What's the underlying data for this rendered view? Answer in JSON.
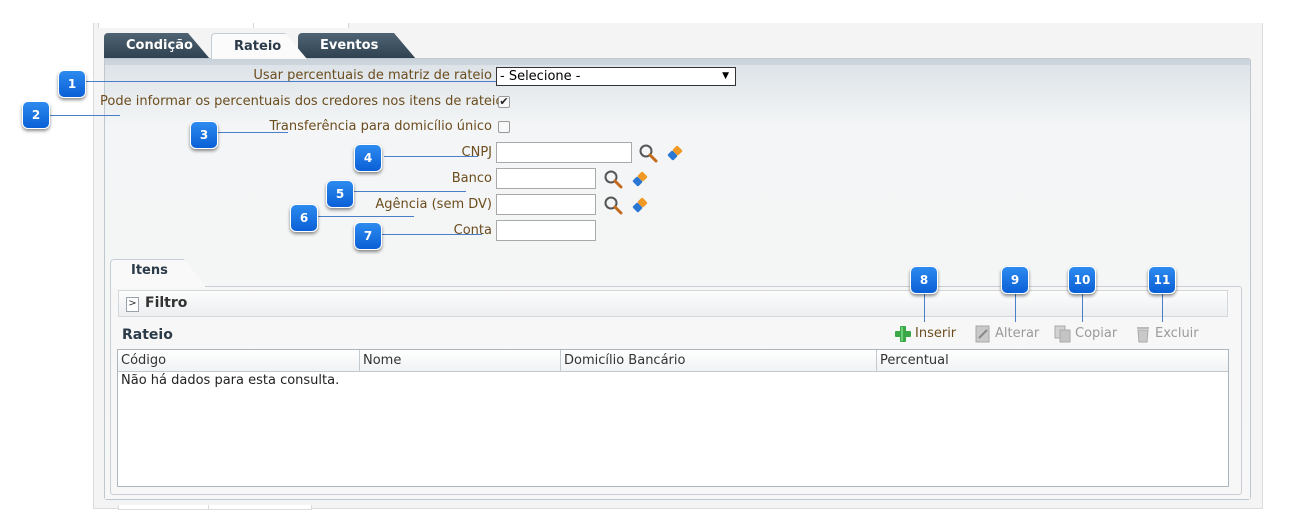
{
  "tabs": [
    {
      "label": "Condição",
      "active": false
    },
    {
      "label": "Rateio",
      "active": true
    },
    {
      "label": "Eventos",
      "active": false
    }
  ],
  "form": {
    "usar_percentuais_label": "Usar percentuais de matriz de rateio",
    "usar_percentuais_value": "- Selecione -",
    "pode_informar_label": "Pode informar os percentuais dos credores nos itens de rateio",
    "pode_informar_checked": true,
    "transferencia_label": "Transferência para domicílio único",
    "transferencia_checked": false,
    "cnpj_label": "CNPJ",
    "banco_label": "Banco",
    "agencia_label": "Agência (sem DV)",
    "conta_label": "Conta"
  },
  "itens": {
    "tab_label": "Itens",
    "filtro_toggle": ">",
    "filtro_label": "Filtro",
    "grid_title": "Rateio",
    "buttons": {
      "inserir": "Inserir",
      "alterar": "Alterar",
      "copiar": "Copiar",
      "excluir": "Excluir"
    },
    "columns": [
      "Código",
      "Nome",
      "Domicílio Bancário",
      "Percentual"
    ],
    "empty_message": "Não há dados para esta consulta."
  },
  "callouts": [
    "1",
    "2",
    "3",
    "4",
    "5",
    "6",
    "7",
    "8",
    "9",
    "10",
    "11"
  ],
  "colors": {
    "label": "#6b4d1e",
    "tab_dark": "#3a4e5e",
    "badge": "#1a73e8",
    "callout_line": "#4a7ec8",
    "insert_green": "#3aa845"
  },
  "icons": {
    "search": "search-icon",
    "clear": "eraser-icon",
    "inserir": "plus-icon",
    "alterar": "edit-icon",
    "copiar": "copy-icon",
    "excluir": "trash-icon"
  }
}
